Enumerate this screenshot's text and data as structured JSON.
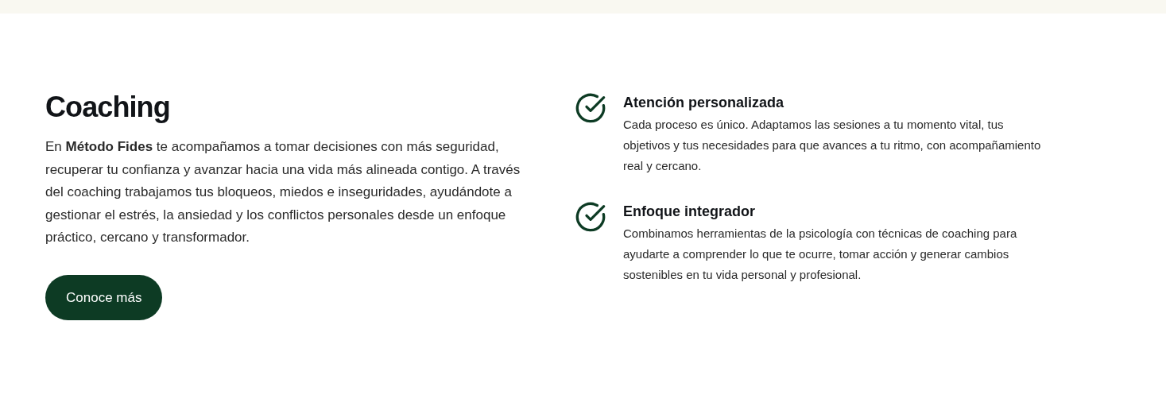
{
  "section": {
    "title": "Coaching",
    "text": "En **Método Fides** te acompañamos a tomar decisiones con más seguridad, recuperar tu confianza y avanzar hacia una vida más alineada contigo. A través del coaching trabajamos tus bloqueos, miedos e inseguridades, ayudándote a gestionar el estrés, la ansiedad y los conflictos personales desde un enfoque práctico, cercano y transformador.",
    "button": "Conoce más"
  },
  "features": [
    {
      "title": "Atención personalizada",
      "text": "Cada proceso es único. Adaptamos las sesiones a tu momento vital, tus objetivos y tus necesidades para que avances a tu ritmo, con acompañamiento real y cercano."
    },
    {
      "title": "Enfoque integrador",
      "text": "Combinamos herramientas de la psicología con técnicas de coaching para ayudarte a comprender lo que te ocurre, tomar acción y generar cambios sostenibles en tu vida personal y profesional."
    }
  ]
}
